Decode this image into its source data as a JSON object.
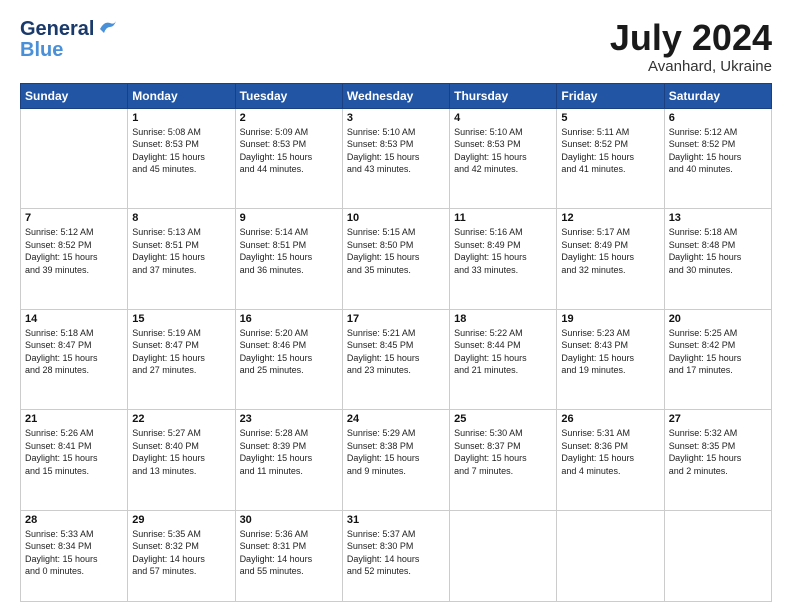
{
  "header": {
    "logo_line1": "General",
    "logo_line2": "Blue",
    "month": "July 2024",
    "location": "Avanhard, Ukraine"
  },
  "weekdays": [
    "Sunday",
    "Monday",
    "Tuesday",
    "Wednesday",
    "Thursday",
    "Friday",
    "Saturday"
  ],
  "weeks": [
    [
      {
        "day": "",
        "text": ""
      },
      {
        "day": "1",
        "text": "Sunrise: 5:08 AM\nSunset: 8:53 PM\nDaylight: 15 hours\nand 45 minutes."
      },
      {
        "day": "2",
        "text": "Sunrise: 5:09 AM\nSunset: 8:53 PM\nDaylight: 15 hours\nand 44 minutes."
      },
      {
        "day": "3",
        "text": "Sunrise: 5:10 AM\nSunset: 8:53 PM\nDaylight: 15 hours\nand 43 minutes."
      },
      {
        "day": "4",
        "text": "Sunrise: 5:10 AM\nSunset: 8:53 PM\nDaylight: 15 hours\nand 42 minutes."
      },
      {
        "day": "5",
        "text": "Sunrise: 5:11 AM\nSunset: 8:52 PM\nDaylight: 15 hours\nand 41 minutes."
      },
      {
        "day": "6",
        "text": "Sunrise: 5:12 AM\nSunset: 8:52 PM\nDaylight: 15 hours\nand 40 minutes."
      }
    ],
    [
      {
        "day": "7",
        "text": "Sunrise: 5:12 AM\nSunset: 8:52 PM\nDaylight: 15 hours\nand 39 minutes."
      },
      {
        "day": "8",
        "text": "Sunrise: 5:13 AM\nSunset: 8:51 PM\nDaylight: 15 hours\nand 37 minutes."
      },
      {
        "day": "9",
        "text": "Sunrise: 5:14 AM\nSunset: 8:51 PM\nDaylight: 15 hours\nand 36 minutes."
      },
      {
        "day": "10",
        "text": "Sunrise: 5:15 AM\nSunset: 8:50 PM\nDaylight: 15 hours\nand 35 minutes."
      },
      {
        "day": "11",
        "text": "Sunrise: 5:16 AM\nSunset: 8:49 PM\nDaylight: 15 hours\nand 33 minutes."
      },
      {
        "day": "12",
        "text": "Sunrise: 5:17 AM\nSunset: 8:49 PM\nDaylight: 15 hours\nand 32 minutes."
      },
      {
        "day": "13",
        "text": "Sunrise: 5:18 AM\nSunset: 8:48 PM\nDaylight: 15 hours\nand 30 minutes."
      }
    ],
    [
      {
        "day": "14",
        "text": "Sunrise: 5:18 AM\nSunset: 8:47 PM\nDaylight: 15 hours\nand 28 minutes."
      },
      {
        "day": "15",
        "text": "Sunrise: 5:19 AM\nSunset: 8:47 PM\nDaylight: 15 hours\nand 27 minutes."
      },
      {
        "day": "16",
        "text": "Sunrise: 5:20 AM\nSunset: 8:46 PM\nDaylight: 15 hours\nand 25 minutes."
      },
      {
        "day": "17",
        "text": "Sunrise: 5:21 AM\nSunset: 8:45 PM\nDaylight: 15 hours\nand 23 minutes."
      },
      {
        "day": "18",
        "text": "Sunrise: 5:22 AM\nSunset: 8:44 PM\nDaylight: 15 hours\nand 21 minutes."
      },
      {
        "day": "19",
        "text": "Sunrise: 5:23 AM\nSunset: 8:43 PM\nDaylight: 15 hours\nand 19 minutes."
      },
      {
        "day": "20",
        "text": "Sunrise: 5:25 AM\nSunset: 8:42 PM\nDaylight: 15 hours\nand 17 minutes."
      }
    ],
    [
      {
        "day": "21",
        "text": "Sunrise: 5:26 AM\nSunset: 8:41 PM\nDaylight: 15 hours\nand 15 minutes."
      },
      {
        "day": "22",
        "text": "Sunrise: 5:27 AM\nSunset: 8:40 PM\nDaylight: 15 hours\nand 13 minutes."
      },
      {
        "day": "23",
        "text": "Sunrise: 5:28 AM\nSunset: 8:39 PM\nDaylight: 15 hours\nand 11 minutes."
      },
      {
        "day": "24",
        "text": "Sunrise: 5:29 AM\nSunset: 8:38 PM\nDaylight: 15 hours\nand 9 minutes."
      },
      {
        "day": "25",
        "text": "Sunrise: 5:30 AM\nSunset: 8:37 PM\nDaylight: 15 hours\nand 7 minutes."
      },
      {
        "day": "26",
        "text": "Sunrise: 5:31 AM\nSunset: 8:36 PM\nDaylight: 15 hours\nand 4 minutes."
      },
      {
        "day": "27",
        "text": "Sunrise: 5:32 AM\nSunset: 8:35 PM\nDaylight: 15 hours\nand 2 minutes."
      }
    ],
    [
      {
        "day": "28",
        "text": "Sunrise: 5:33 AM\nSunset: 8:34 PM\nDaylight: 15 hours\nand 0 minutes."
      },
      {
        "day": "29",
        "text": "Sunrise: 5:35 AM\nSunset: 8:32 PM\nDaylight: 14 hours\nand 57 minutes."
      },
      {
        "day": "30",
        "text": "Sunrise: 5:36 AM\nSunset: 8:31 PM\nDaylight: 14 hours\nand 55 minutes."
      },
      {
        "day": "31",
        "text": "Sunrise: 5:37 AM\nSunset: 8:30 PM\nDaylight: 14 hours\nand 52 minutes."
      },
      {
        "day": "",
        "text": ""
      },
      {
        "day": "",
        "text": ""
      },
      {
        "day": "",
        "text": ""
      }
    ]
  ]
}
